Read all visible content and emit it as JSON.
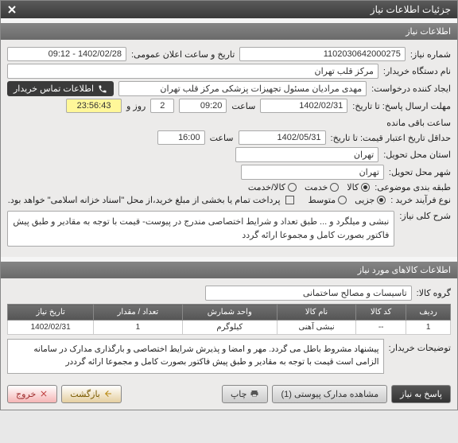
{
  "window": {
    "title": "جزئیات اطلاعات نیاز"
  },
  "panels": {
    "need_info": "اطلاعات نیاز",
    "items_info": "اطلاعات کالاهای مورد نیاز"
  },
  "fields": {
    "need_no_lbl": "شماره نیاز:",
    "need_no": "1102030642000275",
    "pub_date_lbl": "تاریخ و ساعت اعلان عمومی:",
    "pub_date": "1402/02/28 - 09:12",
    "buyer_dev_lbl": "نام دستگاه خریدار:",
    "buyer_dev": "مرکز قلب تهران",
    "requester_lbl": "ایجاد کننده درخواست:",
    "requester": "مهدی مرادیان مسئول تجهیزات پزشکی مرکز قلب تهران",
    "contact_btn": "اطلاعات تماس خریدار",
    "send_deadline_lbl": "مهلت ارسال پاسخ: تا تاریخ:",
    "send_deadline_date": "1402/02/31",
    "hour_lbl": "ساعت",
    "send_deadline_time": "09:20",
    "days_lbl": "روز و",
    "days_remain": "2",
    "time_remain": "23:56:43",
    "remain_suffix": "ساعت باقی مانده",
    "valid_deadline_lbl": "حداقل تاریخ اعتبار قیمت: تا تاریخ:",
    "valid_deadline_date": "1402/05/31",
    "valid_deadline_time": "16:00",
    "proj_state_lbl": "استان محل تحویل:",
    "proj_state": "تهران",
    "proj_city_lbl": "شهر محل تحویل:",
    "proj_city": "تهران",
    "subject_class_lbl": "طبقه بندی موضوعی:",
    "subject_goods": "کالا",
    "subject_service": "خدمت",
    "subject_goods_service": "کالا/خدمت",
    "buy_process_lbl": "نوع فرآیند خرید :",
    "buy_partial": "جزیی",
    "buy_medium": "متوسط",
    "pay_note": "پرداخت تمام یا بخشی از مبلغ خرید،از محل \"اسناد خزانه اسلامی\" خواهد بود.",
    "need_desc_lbl": "شرح کلی نیاز:",
    "need_desc": "نبشی و میلگرد و ... طبق تعداد و شرایط اختصاصی مندرج در پیوست- قیمت با توجه به مقادیر و طبق پیش فاکتور بصورت کامل و مجموعا ارائه گردد",
    "goods_group_lbl": "گروه کالا:",
    "goods_group": "تاسیسات و مصالح ساختمانی",
    "buyer_notes_lbl": "توضیحات خریدار:",
    "buyer_notes": "پیشنهاد مشروط باطل می گردد. مهر و امضا و پذیرش شرایط اختصاصی و بارگذاری مدارک در سامانه الزامی است قیمت با توجه به مقادیر و طبق پیش فاکتور بصورت کامل و مجموعا ارائه گرددر"
  },
  "table": {
    "headers": {
      "row": "ردیف",
      "code": "کد کالا",
      "name": "نام کالا",
      "unit": "واحد شمارش",
      "qty": "تعداد / مقدار",
      "date": "تاریخ نیاز"
    },
    "rows": [
      {
        "row": "1",
        "code": "--",
        "name": "نبشی آهنی",
        "unit": "کیلوگرم",
        "qty": "1",
        "date": "1402/02/31"
      }
    ]
  },
  "footer": {
    "reply": "پاسخ به نیاز",
    "attachments": "مشاهده مدارک پیوستی (1)",
    "print": "چاپ",
    "back": "بازگشت",
    "exit": "خروج"
  }
}
